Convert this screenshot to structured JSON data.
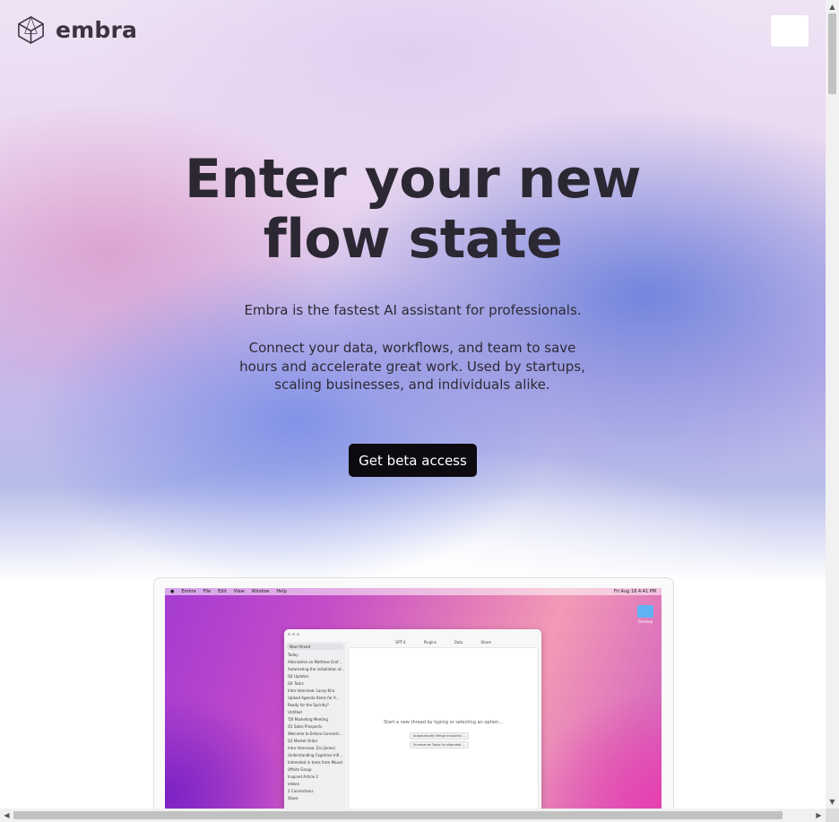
{
  "brand": {
    "name": "embra"
  },
  "hero": {
    "title_line1": "Enter your new",
    "title_line2": "flow state",
    "subtitle": "Embra is the fastest AI assistant for professionals.",
    "description": "Connect your data, workflows, and team to save hours and accelerate great work. Used by startups, scaling businesses, and individuals alike.",
    "cta_label": "Get beta access"
  },
  "screenshot": {
    "menubar_items": [
      "Embra",
      "File",
      "Edit",
      "View",
      "Window",
      "Help"
    ],
    "menubar_time": "Fri Aug 18 4:41 PM",
    "desktop_folder_label": "Desktop",
    "new_thread_label": "New thread",
    "sidebar_section": "Today",
    "sidebar_items": [
      "Alternative on Matthew Gref...",
      "Automating the installation of...",
      "Q4 Updates",
      "Q4 Tasks",
      "Intro Interview: Lacey Kira",
      "Upload Agenda Items for A...",
      "Ready for the Sprintly?",
      "Untitled",
      "TJX Marketing Meeting",
      "Q1 Sales Prospects",
      "Welcome to Embra Connecti...",
      "Q1 Market Order",
      "Intro Interview: Zai (Jones)",
      "Understanding Cognitive Infl...",
      "Interested in trees from Mount",
      "Offsite Group",
      "Inspired Article 2"
    ],
    "user_name": "embra",
    "user_plan": "2 Connections",
    "sidebar_footer": "Share",
    "toolbar": [
      "GPT-4",
      "Plugins",
      "Data"
    ],
    "toolbar_share": "Share",
    "empty_state": "Start a new thread by typing or selecting an option...",
    "chip1_a": "Automatically",
    "chip1_b": "Merge industrial ...",
    "chip2_a": "Summarize",
    "chip2_b": "Tasks for attended ..."
  }
}
